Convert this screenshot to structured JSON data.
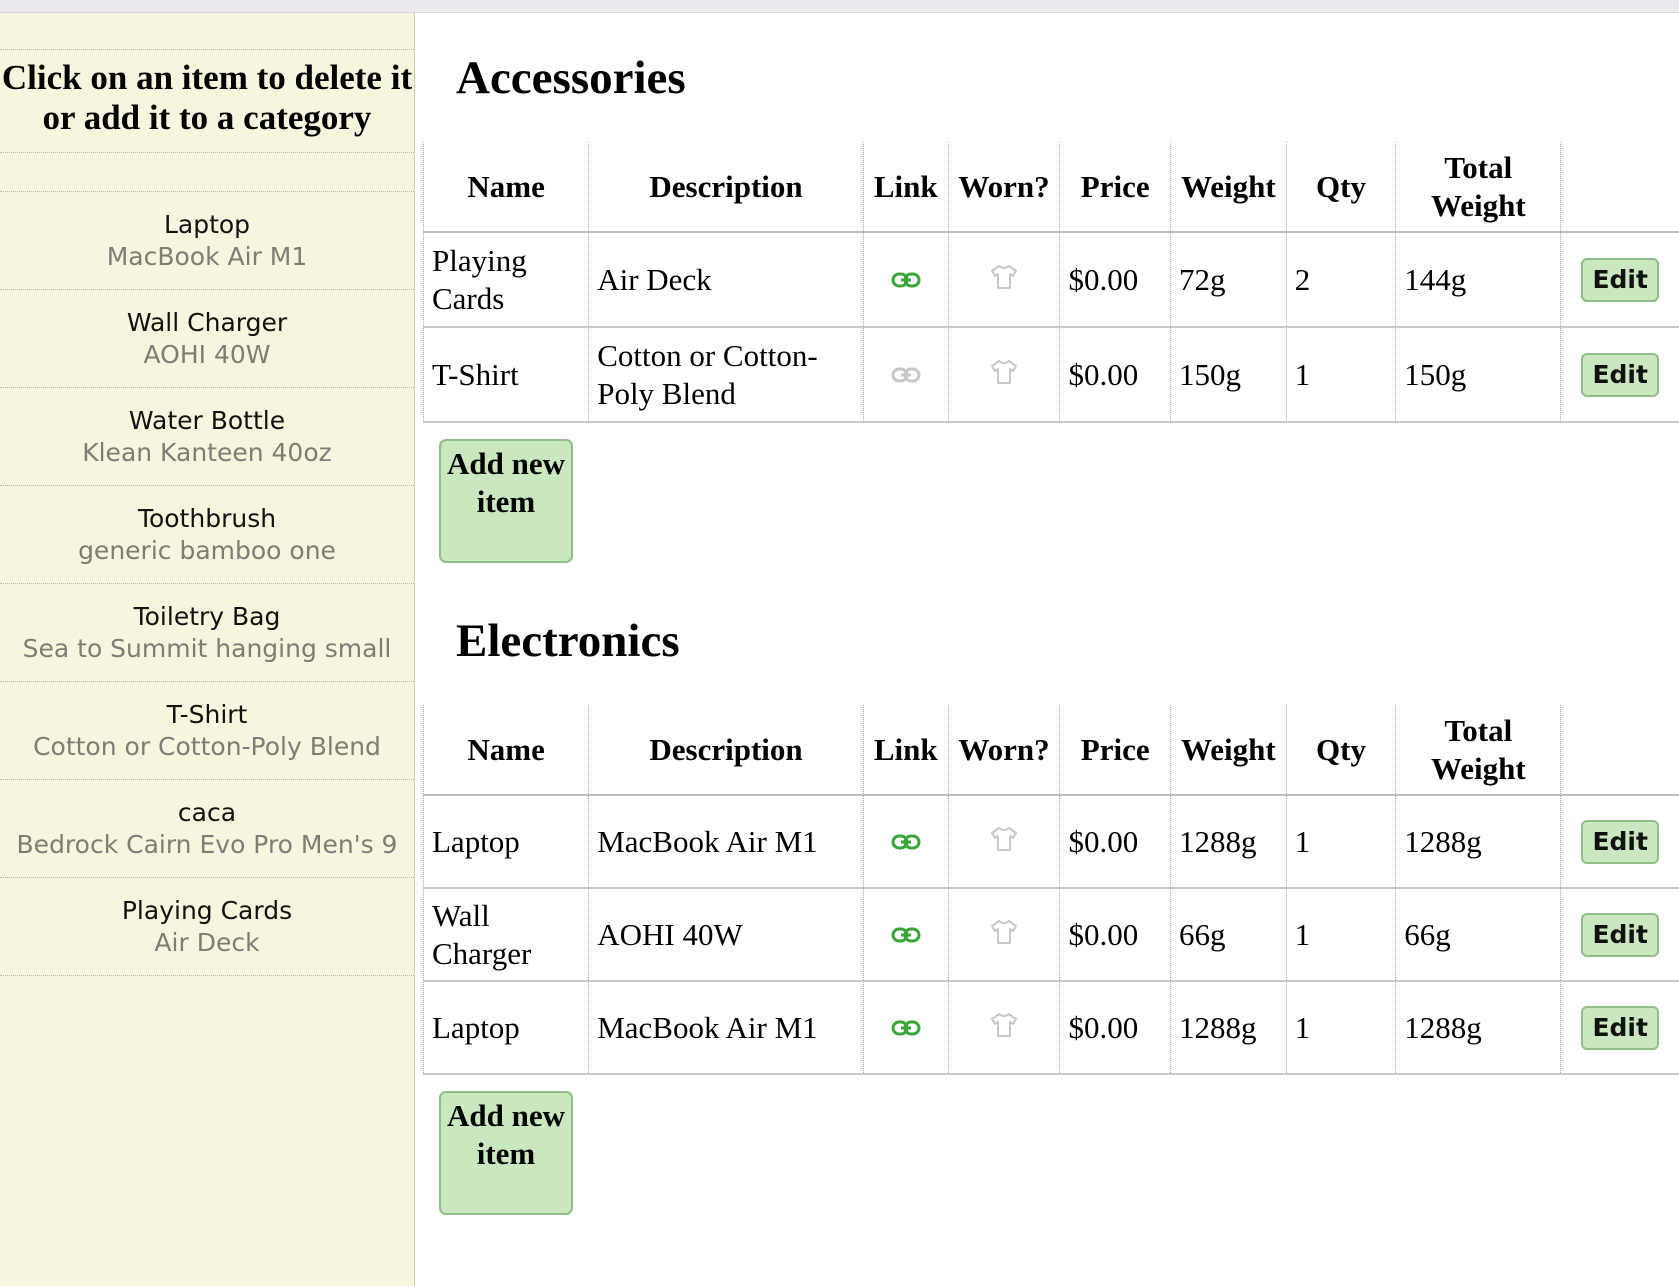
{
  "sidebar": {
    "title": "Click on an item to delete it or add it to a category",
    "items": [
      {
        "name": "Laptop",
        "description": "MacBook Air M1"
      },
      {
        "name": "Wall Charger",
        "description": "AOHI 40W"
      },
      {
        "name": "Water Bottle",
        "description": "Klean Kanteen 40oz"
      },
      {
        "name": "Toothbrush",
        "description": "generic bamboo one"
      },
      {
        "name": "Toiletry Bag",
        "description": "Sea to Summit hanging small"
      },
      {
        "name": "T-Shirt",
        "description": "Cotton or Cotton-Poly Blend"
      },
      {
        "name": "caca",
        "description": "Bedrock Cairn Evo Pro Men's 9"
      },
      {
        "name": "Playing Cards",
        "description": "Air Deck"
      }
    ]
  },
  "headers": {
    "name": "Name",
    "description": "Description",
    "link": "Link",
    "worn": "Worn?",
    "price": "Price",
    "weight": "Weight",
    "qty": "Qty",
    "total_weight": "Total Weight"
  },
  "edit_label": "Edit",
  "add_label": "Add new item",
  "colors": {
    "link_active": "#3aa63a",
    "link_inactive": "#c8c8c8",
    "worn_icon": "#c8c8c8",
    "button_bg": "#c9e8c0",
    "sidebar_bg": "#f7f5dd"
  },
  "categories": [
    {
      "title": "Accessories",
      "rows": [
        {
          "name": "Playing Cards",
          "description": "Air Deck",
          "link_active": true,
          "price": "$0.00",
          "weight": "72g",
          "qty": "2",
          "total_weight": "144g"
        },
        {
          "name": "T-Shirt",
          "description": "Cotton or Cotton-Poly Blend",
          "link_active": false,
          "price": "$0.00",
          "weight": "150g",
          "qty": "1",
          "total_weight": "150g"
        }
      ]
    },
    {
      "title": "Electronics",
      "rows": [
        {
          "name": "Laptop",
          "description": "MacBook Air M1",
          "link_active": true,
          "price": "$0.00",
          "weight": "1288g",
          "qty": "1",
          "total_weight": "1288g"
        },
        {
          "name": "Wall Charger",
          "description": "AOHI 40W",
          "link_active": true,
          "price": "$0.00",
          "weight": "66g",
          "qty": "1",
          "total_weight": "66g"
        },
        {
          "name": "Laptop",
          "description": "MacBook Air M1",
          "link_active": true,
          "price": "$0.00",
          "weight": "1288g",
          "qty": "1",
          "total_weight": "1288g"
        }
      ]
    }
  ]
}
